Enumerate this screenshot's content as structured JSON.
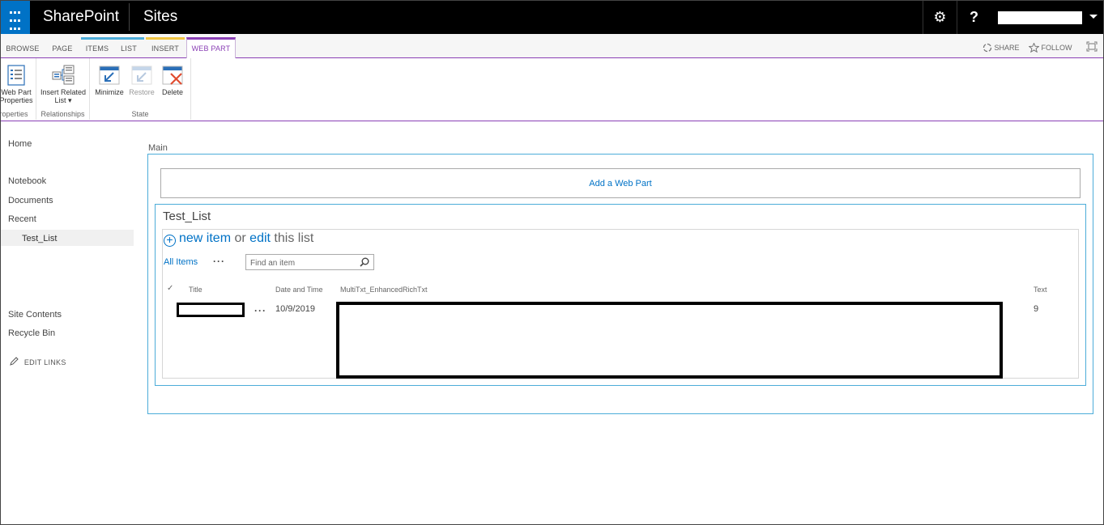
{
  "suite_bar": {
    "brand": "SharePoint",
    "app": "Sites",
    "settings_glyph": "⚙",
    "help_glyph": "?"
  },
  "ribbon_tabs": [
    {
      "label": "BROWSE"
    },
    {
      "label": "PAGE"
    },
    {
      "label": "ITEMS"
    },
    {
      "label": "LIST"
    },
    {
      "label": "INSERT"
    },
    {
      "label": "WEB PART"
    }
  ],
  "ribbon_actions": {
    "share": "SHARE",
    "follow": "FOLLOW"
  },
  "ribbon_groups": {
    "properties": {
      "label": "roperties",
      "button_line1": "Web Part",
      "button_line2": "Properties"
    },
    "relationships": {
      "label": "Relationships",
      "button_line1": "Insert Related",
      "button_line2": "List ▾"
    },
    "state": {
      "label": "State",
      "minimize": "Minimize",
      "restore": "Restore",
      "delete": "Delete"
    }
  },
  "left_nav": {
    "home": "Home",
    "notebook": "Notebook",
    "documents": "Documents",
    "recent": "Recent",
    "recent_child": "Test_List",
    "site_contents": "Site Contents",
    "recycle_bin": "Recycle Bin",
    "edit_links": "EDIT LINKS"
  },
  "main": {
    "zone_title": "Main",
    "add_web_part": "Add a Web Part",
    "web_part": {
      "title": "Test_List",
      "new_item": "new item",
      "or": "or",
      "edit": "edit",
      "this_list": "this list",
      "view_name": "All Items",
      "ellipsis": "···",
      "search_placeholder": "Find an item"
    },
    "table": {
      "check_glyph": "✓",
      "columns": [
        "Title",
        "Date and Time",
        "MultiTxt_EnhancedRichTxt",
        "Text"
      ],
      "rows": [
        {
          "title": "",
          "date": "10/9/2019",
          "rich_text": "",
          "text": "9"
        }
      ]
    }
  },
  "colors": {
    "suite_bar": "#000000",
    "waffle": "#0072c6",
    "link_blue": "#0072c6",
    "webpart_accent": "#8a3fb5",
    "zone_border": "#4cacd9"
  }
}
